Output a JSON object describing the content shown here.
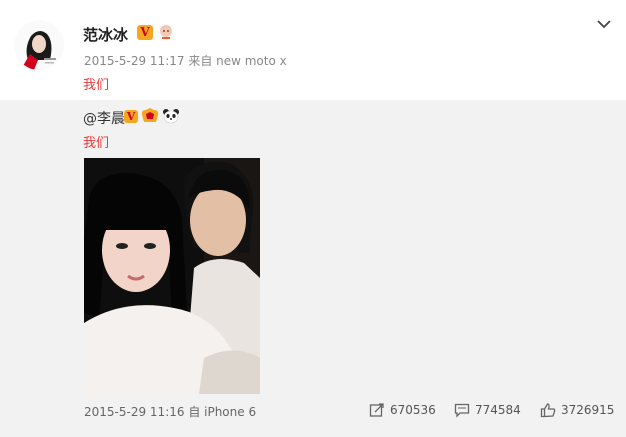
{
  "post": {
    "author": "范冰冰",
    "verified_mark": "V",
    "meta": "2015-5-29 11:17 来自 new moto x",
    "text": "我们"
  },
  "repost": {
    "mention": "@李晨",
    "verified_mark": "V",
    "text": "我们",
    "meta": "2015-5-29 11:16 自 iPhone 6",
    "stats": {
      "reposts": "670536",
      "comments": "774584",
      "likes": "3726915"
    }
  },
  "colors": {
    "link_red": "#e63a3a",
    "verified_gold": "#f5a623",
    "panel_bg": "#f2f2f2"
  },
  "icons": [
    "chevron-down-icon",
    "repost-icon",
    "comment-icon",
    "like-icon"
  ]
}
